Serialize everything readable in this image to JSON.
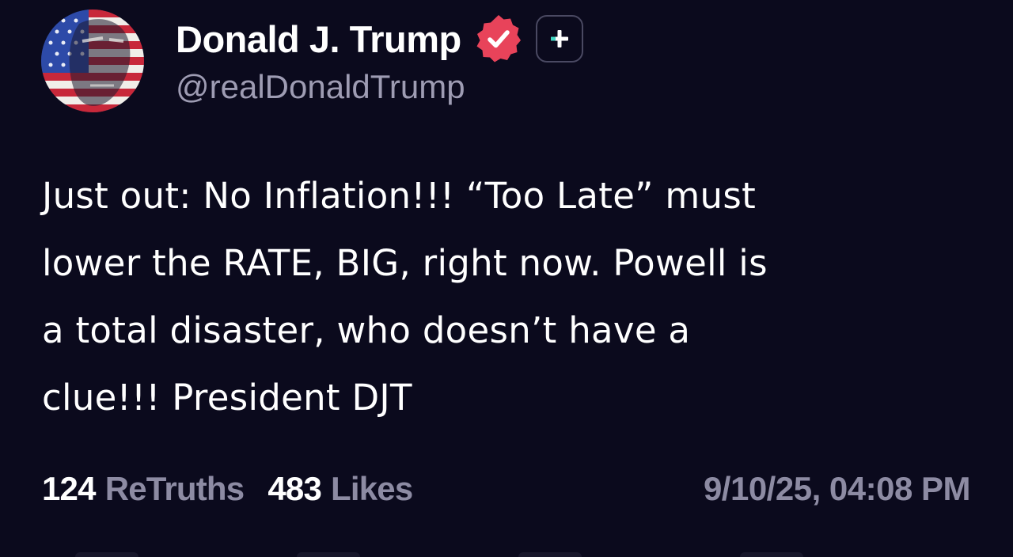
{
  "post": {
    "author": {
      "display_name": "Donald J. Trump",
      "handle": "@realDonaldTrump",
      "verified": true,
      "badge_color": "#e8435a"
    },
    "body_lines": [
      "Just out: No Inflation!!! “Too Late” must",
      "lower the RATE, BIG, right now. Powell is",
      "a total disaster, who doesn’t have a",
      "clue!!! President DJT"
    ],
    "stats": {
      "retruths_count": "124",
      "retruths_label": "ReTruths",
      "likes_count": "483",
      "likes_label": "Likes"
    },
    "timestamp": "9/10/25, 04:08 PM"
  },
  "colors": {
    "background": "#0b0a1d",
    "text_primary": "#ffffff",
    "text_secondary": "#8d8ba3",
    "accent": "#e8435a"
  },
  "icons": {
    "verified": "verified-badge-icon",
    "follow": "plus-icon"
  }
}
